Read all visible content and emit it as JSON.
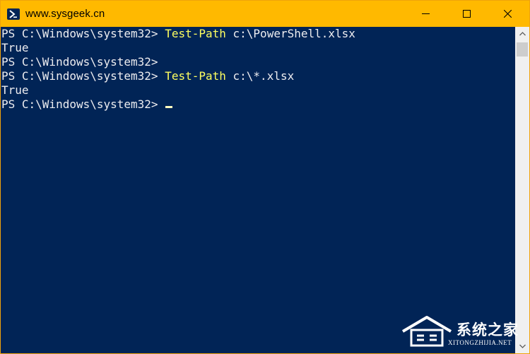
{
  "window": {
    "title": "www.sysgeek.cn",
    "accent_color": "#ffb900",
    "console_background": "#012456",
    "icon": "powershell-icon"
  },
  "controls": {
    "minimize_icon": "minimize-icon",
    "maximize_icon": "maximize-icon",
    "close_icon": "close-icon"
  },
  "console": {
    "lines": [
      {
        "prompt": "PS C:\\Windows\\system32> ",
        "command": "Test-Path",
        "args": " c:\\PowerShell.xlsx"
      },
      {
        "output": "True"
      },
      {
        "prompt": "PS C:\\Windows\\system32>",
        "command": "",
        "args": ""
      },
      {
        "prompt": "PS C:\\Windows\\system32> ",
        "command": "Test-Path",
        "args": " c:\\*.xlsx"
      },
      {
        "output": "True"
      },
      {
        "prompt": "PS C:\\Windows\\system32> ",
        "command": "",
        "args": ""
      }
    ],
    "command_color": "#ffff60",
    "text_color": "#eeedf0"
  },
  "watermark": {
    "name": "系统之家",
    "url": "XITONGZHIJIA.NET"
  }
}
